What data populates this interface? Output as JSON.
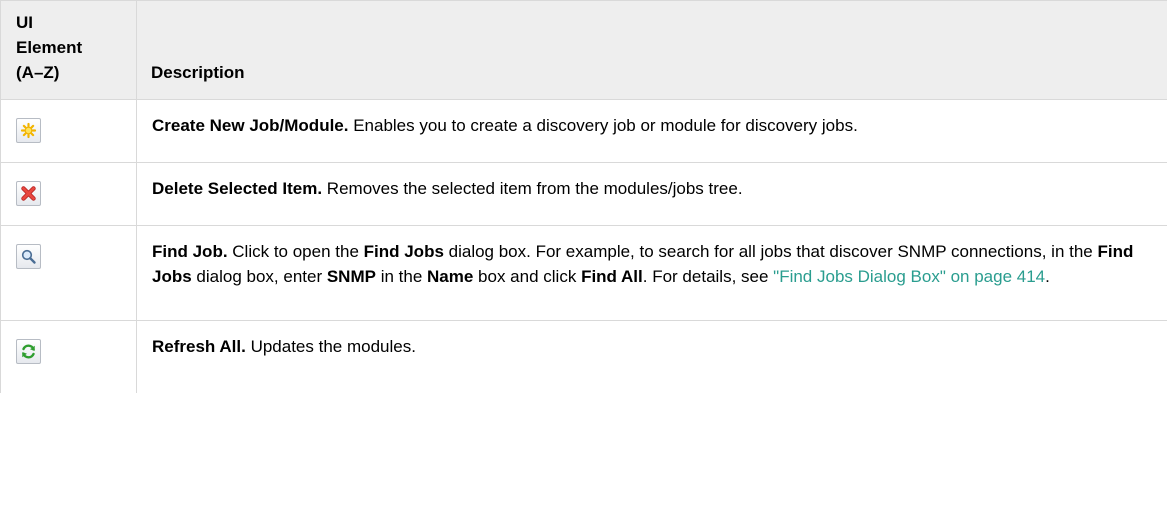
{
  "table": {
    "headers": {
      "col1": "UI\nElement\n(A–Z)",
      "col2": "Description"
    },
    "rows": [
      {
        "icon": "create-new-job-icon",
        "title": "Create New Job/Module.",
        "text": " Enables you to create a discovery job or module for discovery jobs."
      },
      {
        "icon": "delete-selected-item-icon",
        "title": "Delete Selected Item.",
        "text": " Removes the selected item from the modules/jobs tree."
      },
      {
        "icon": "find-job-icon",
        "title": "Find Job.",
        "t1": " Click to open the ",
        "b1": "Find Jobs",
        "t2": " dialog box. For example, to search for all jobs that discover SNMP connections, in the ",
        "b2": "Find Jobs",
        "t3": " dialog box, enter ",
        "b3": "SNMP",
        "t4": " in the ",
        "b4": "Name",
        "t5": " box and click ",
        "b5": "Find All",
        "t6": ". For details, see ",
        "link": "\"Find Jobs Dialog Box\" on page 414",
        "t7": "."
      },
      {
        "icon": "refresh-all-icon",
        "title": "Refresh All.",
        "text": " Updates the modules."
      }
    ]
  },
  "colors": {
    "header_bg": "#eeeeee",
    "border": "#d9d9d9",
    "link": "#2a9d8f"
  }
}
